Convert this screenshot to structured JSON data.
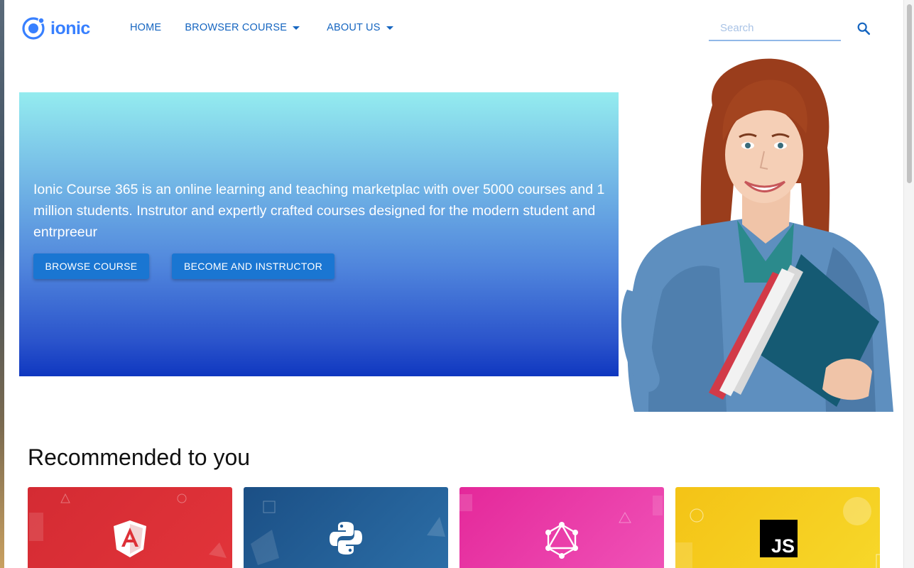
{
  "header": {
    "logo_text": "ionic",
    "nav": [
      {
        "label": "HOME",
        "has_dropdown": false
      },
      {
        "label": "BROWSER COURSE",
        "has_dropdown": true
      },
      {
        "label": "ABOUT US",
        "has_dropdown": true
      }
    ],
    "search": {
      "placeholder": "Search",
      "value": ""
    },
    "search_icon": "search-icon",
    "accent_color": "#1565c0"
  },
  "hero": {
    "text": "Ionic Course 365 is an online learning and teaching marketplac with over 5000 courses and 1 million students. Instrutor and expertly crafted courses designed for the modern student and entrpreeur",
    "buttons": {
      "browse": "BROWSE COURSE",
      "instructor": "BECOME AND INSTRUCTOR"
    },
    "image": "student-holding-notebooks"
  },
  "recommended": {
    "title": "Recommended to you",
    "cards": [
      {
        "course_icon": "angular-icon",
        "color": "#d93036"
      },
      {
        "course_icon": "python-icon",
        "color": "#1e5a96"
      },
      {
        "course_icon": "graphql-icon",
        "color": "#e8359f"
      },
      {
        "course_icon": "javascript-icon",
        "color": "#f5cc1a",
        "badge": "JS"
      }
    ]
  }
}
